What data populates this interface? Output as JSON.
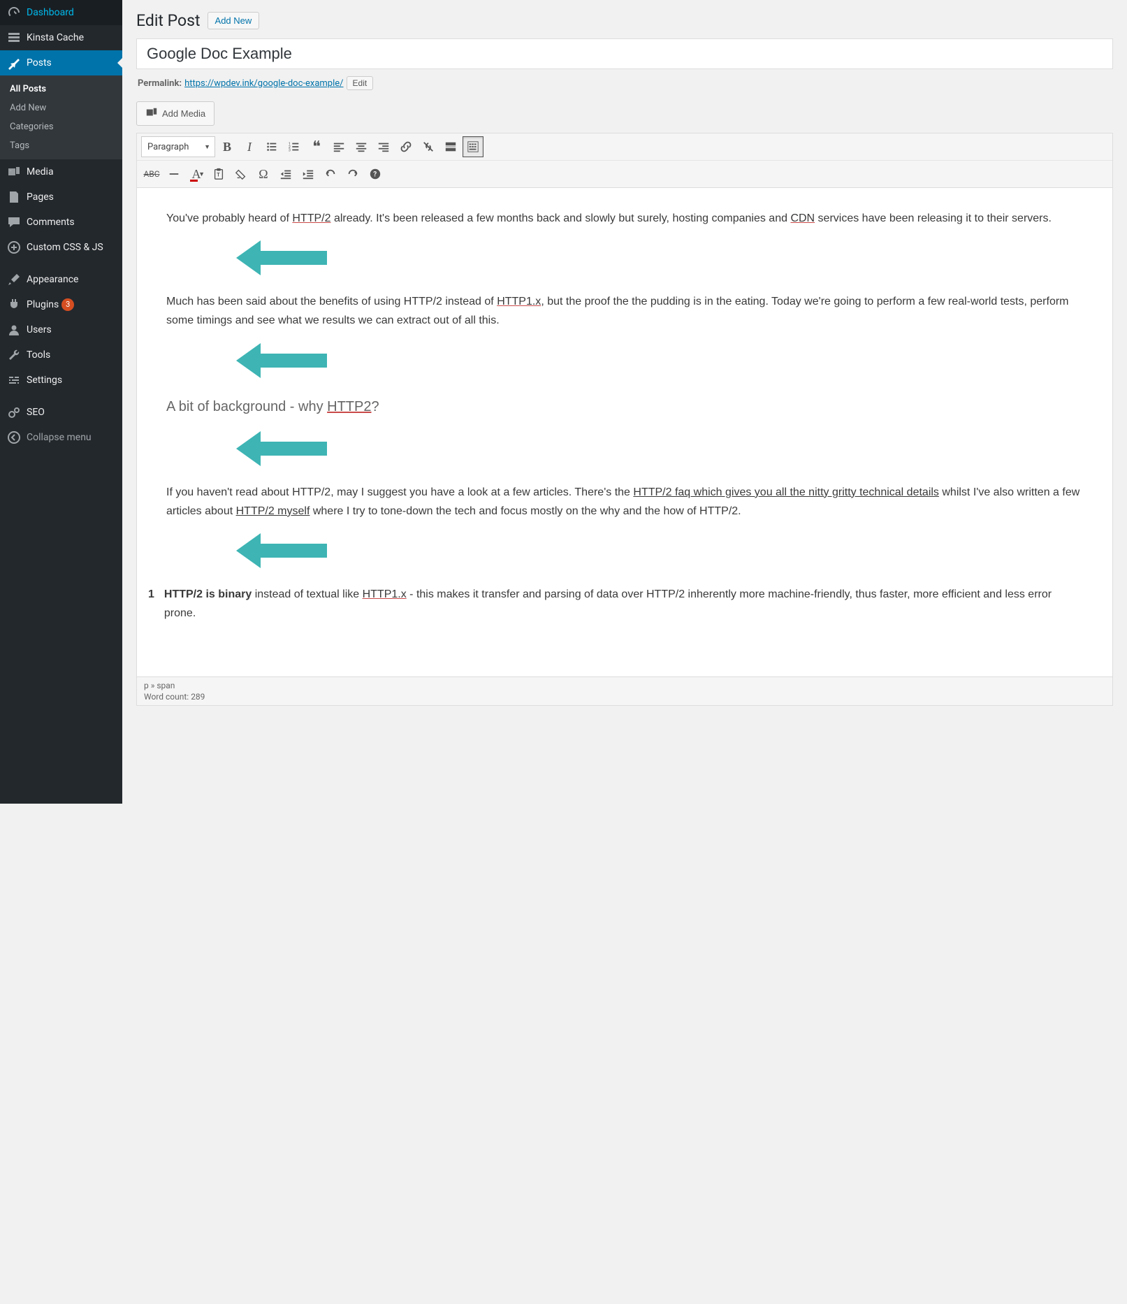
{
  "sidebar": {
    "items": [
      {
        "key": "dashboard",
        "label": "Dashboard"
      },
      {
        "key": "kinsta-cache",
        "label": "Kinsta Cache"
      },
      {
        "key": "posts",
        "label": "Posts",
        "active": true
      },
      {
        "key": "media",
        "label": "Media"
      },
      {
        "key": "pages",
        "label": "Pages"
      },
      {
        "key": "comments",
        "label": "Comments"
      },
      {
        "key": "custom-css-js",
        "label": "Custom CSS & JS"
      },
      {
        "key": "appearance",
        "label": "Appearance"
      },
      {
        "key": "plugins",
        "label": "Plugins",
        "badge": "3"
      },
      {
        "key": "users",
        "label": "Users"
      },
      {
        "key": "tools",
        "label": "Tools"
      },
      {
        "key": "settings",
        "label": "Settings"
      },
      {
        "key": "seo",
        "label": "SEO"
      },
      {
        "key": "collapse",
        "label": "Collapse menu"
      }
    ],
    "submenu": [
      {
        "label": "All Posts",
        "active": true
      },
      {
        "label": "Add New"
      },
      {
        "label": "Categories"
      },
      {
        "label": "Tags"
      }
    ]
  },
  "header": {
    "title": "Edit Post",
    "add_new": "Add New"
  },
  "post": {
    "title": "Google Doc Example",
    "permalink_label": "Permalink:",
    "permalink_base": "https://wpdev.ink/",
    "permalink_slug": "google-doc-example/",
    "edit_btn": "Edit"
  },
  "buttons": {
    "add_media": "Add Media"
  },
  "toolbar": {
    "format": "Paragraph"
  },
  "content": {
    "p1_a": "You've probably heard of ",
    "p1_http2": "HTTP/2",
    "p1_b": " already. It's been released a few months back and slowly but surely, hosting companies and ",
    "p1_cdn": "CDN",
    "p1_c": " services have been releasing it to their servers.",
    "p2_a": "Much has been said about the benefits of using HTTP/2 instead of ",
    "p2_http1": "HTTP1.x",
    "p2_b": ", but the proof the the pudding is in the eating. Today we're going to perform a few real-world tests, perform some timings and see what we results we can extract out of all this.",
    "h2_a": "A bit of background - why ",
    "h2_http2": "HTTP2",
    "h2_b": "?",
    "p3_a": "If you haven't read about HTTP/2, may I suggest you have a look at a few articles. There's the ",
    "p3_link1": "HTTP/2 faq which gives you all the nitty gritty technical details",
    "p3_b": " whilst I've also written a few articles about ",
    "p3_link2": "HTTP/2 myself",
    "p3_c": " where I try to tone-down the tech and focus mostly on the why and the how of HTTP/2.",
    "li1_num": "1",
    "li1_bold": "HTTP/2 is binary",
    "li1_rest_a": " instead of textual like ",
    "li1_http1": "HTTP1.x",
    "li1_rest_b": " - this makes it transfer and parsing of data over HTTP/2 inherently more machine-friendly, thus faster, more efficient and less error prone."
  },
  "status": {
    "path": "p » span",
    "wordcount_label": "Word count: ",
    "wordcount": "289"
  },
  "colors": {
    "arrow": "#3eb4b4"
  }
}
